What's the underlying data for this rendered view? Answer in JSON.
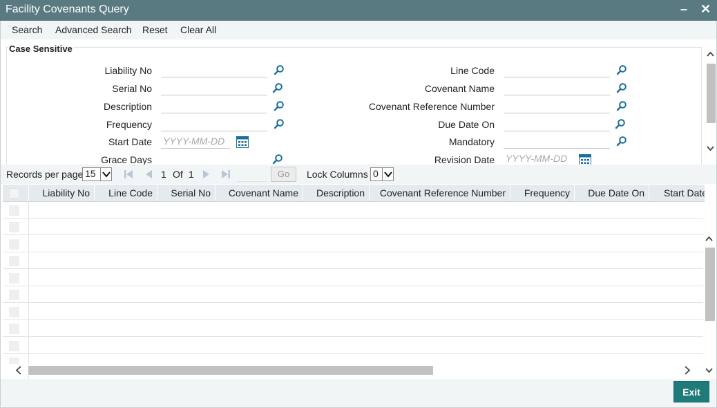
{
  "window": {
    "title": "Facility Covenants Query"
  },
  "menu": {
    "search": "Search",
    "advanced_search": "Advanced Search",
    "reset": "Reset",
    "clear_all": "Clear All"
  },
  "criteria": {
    "legend": "Case Sensitive",
    "left": {
      "liability_no": "Liability No",
      "serial_no": "Serial No",
      "description": "Description",
      "frequency": "Frequency",
      "start_date": "Start Date",
      "grace_days": "Grace Days"
    },
    "right": {
      "line_code": "Line Code",
      "covenant_name": "Covenant Name",
      "covenant_reference_number": "Covenant Reference Number",
      "due_date_on": "Due Date On",
      "mandatory": "Mandatory",
      "revision_date": "Revision Date"
    },
    "date_placeholder": "YYYY-MM-DD"
  },
  "pager": {
    "records_per_page_label": "Records per page",
    "records_per_page_value": "15",
    "current_page": "1",
    "of_label": "Of",
    "total_pages": "1",
    "go_label": "Go",
    "lock_columns_label": "Lock Columns",
    "lock_columns_value": "0"
  },
  "grid": {
    "columns": [
      "Liability No",
      "Line Code",
      "Serial No",
      "Covenant Name",
      "Description",
      "Covenant Reference Number",
      "Frequency",
      "Due Date On",
      "Start Date"
    ]
  },
  "footer": {
    "exit_label": "Exit"
  },
  "colors": {
    "titlebar": "#5a7a82",
    "accent": "#1f7a7a",
    "icon": "#1a6f9a"
  }
}
